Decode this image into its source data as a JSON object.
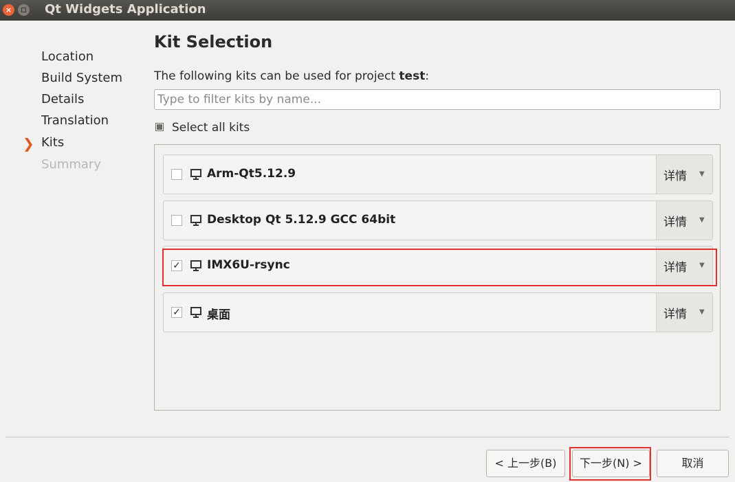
{
  "window": {
    "title": "Qt Widgets Application"
  },
  "nav": {
    "items": [
      {
        "label": "Location",
        "state": "done"
      },
      {
        "label": "Build System",
        "state": "done"
      },
      {
        "label": "Details",
        "state": "done"
      },
      {
        "label": "Translation",
        "state": "done"
      },
      {
        "label": "Kits",
        "state": "current"
      },
      {
        "label": "Summary",
        "state": "disabled"
      }
    ]
  },
  "page": {
    "title": "Kit Selection",
    "subtitle_prefix": "The following kits can be used for project ",
    "project_name": "test",
    "subtitle_suffix": ":",
    "filter": {
      "value": "",
      "placeholder": "Type to filter kits by name..."
    },
    "select_all": {
      "label": "Select all kits",
      "state": "partial"
    }
  },
  "kits": [
    {
      "name": "Arm-Qt5.12.9",
      "checked": false,
      "details_label": "详情",
      "icon": "monitor-icon"
    },
    {
      "name": "Desktop Qt 5.12.9 GCC 64bit",
      "checked": false,
      "details_label": "详情",
      "icon": "monitor-icon"
    },
    {
      "name": "IMX6U-rsync",
      "checked": true,
      "details_label": "详情",
      "icon": "monitor-icon"
    },
    {
      "name": "桌面",
      "checked": true,
      "details_label": "详情",
      "icon": "monitor-icon"
    }
  ],
  "buttons": {
    "back": "< 上一步(B)",
    "next": "下一步(N) >",
    "cancel": "取消"
  },
  "colors": {
    "titlebar": "#3c3b37",
    "accent_arrow": "#e0561c",
    "highlight": "#e03030",
    "background": "#f2f1f0"
  }
}
